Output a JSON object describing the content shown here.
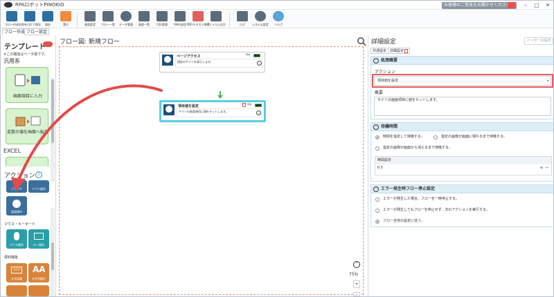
{
  "window": {
    "title": "RPAロボットPINOKIO",
    "feedback": "お客様のご意見をお聞かせください",
    "controls": [
      "‒",
      "□",
      "✕"
    ]
  },
  "toolbar": {
    "buttons": [
      {
        "label": "フロー作成",
        "icon": "new-flow-icon",
        "color": "#2f6f9f"
      },
      {
        "label": "名前を付けて保存",
        "icon": "save-as-icon",
        "color": "#2f6f9f"
      },
      {
        "label": "保存",
        "icon": "save-icon",
        "color": "#2f6f9f"
      },
      {
        "label": "実行",
        "icon": "run-icon",
        "color": "#f08a3c"
      },
      {
        "label": "画面設定",
        "icon": "screen-settings-icon",
        "color": "#5c6b7a"
      },
      {
        "label": "フロー一覧",
        "icon": "flow-list-icon",
        "color": "#5c6b7a"
      },
      {
        "label": "データ管理",
        "icon": "data-management-icon",
        "color": "#5c6b7a"
      },
      {
        "label": "画面一覧",
        "icon": "screen-list-icon",
        "color": "#5c6b7a"
      },
      {
        "label": "CSV変換",
        "icon": "csv-convert-icon",
        "color": "#5c6b7a"
      },
      {
        "label": "MAIL送信",
        "icon": "mail-send-icon",
        "color": "#5c6b7a"
      },
      {
        "label": "PDF/テキスト取得",
        "icon": "pdf-text-icon",
        "color": "#e06060"
      },
      {
        "label": "ファイル入出力",
        "icon": "file-io-icon",
        "color": "#5c6b7a"
      },
      {
        "label": "ログ",
        "icon": "log-icon",
        "color": "#5c6b7a"
      },
      {
        "label": "システム設定",
        "icon": "system-settings-icon",
        "color": "#5c6b7a"
      },
      {
        "label": "ヘルプ",
        "icon": "help-icon",
        "color": "#5aa3d9"
      }
    ]
  },
  "subtabs": [
    "フロー作成",
    "フロー設定"
  ],
  "template_panel": {
    "title": "テンプレート",
    "note": "※この機能はベータ版です。",
    "groups": [
      {
        "name": "汎用系",
        "cards": [
          {
            "label": "画面項目に入力"
          },
          {
            "label": "変数の値を画面へ転記"
          }
        ]
      },
      {
        "name": "EXCEL",
        "cards": []
      }
    ]
  },
  "action_panel": {
    "title": "アクション",
    "help": "?",
    "tiles_row1": [
      "ブラウザ",
      "アプリ操作"
    ],
    "tile_selected": "画面操作",
    "cat_mouse": "マウス・キーボード",
    "tiles_row2": [
      "マウス操作",
      "キー操作"
    ],
    "cat_util": "便利機能",
    "tiles_row3": [
      "文字認識",
      "文字列操作"
    ]
  },
  "flow": {
    "title": "フロー図: 新規フロー",
    "nodes": [
      {
        "title": "ページアクセス",
        "desc": "指定のサイトを表示します。",
        "status": "有効"
      },
      {
        "title": "項目値を設定",
        "desc": "サイトの画面項目に値をセットします。",
        "status": "有効"
      }
    ],
    "zoom": "75%",
    "zoom_in": "+",
    "zoom_out": "-"
  },
  "detail": {
    "title": "詳細設定",
    "trigger": "トリガーの設定",
    "tabs": [
      "共通設定",
      "詳細設定"
    ],
    "sections": [
      {
        "title": "処理概要",
        "action_label": "アクション",
        "action_value": "項目値を設定",
        "summary_label": "概要",
        "summary_value": "サイトの画面項目に値をセットします。"
      },
      {
        "title": "待機時間",
        "options": [
          {
            "label": "時間を指定して待機する。",
            "checked": true
          },
          {
            "label": "指定の画像が画面に現れるまで待機する。",
            "checked": false
          },
          {
            "label": "指定の画像が画面から消えるまで待機する。",
            "checked": false
          }
        ],
        "time_label": "時間設定",
        "time_value": "0.5",
        "time_ctrl": "+ −"
      },
      {
        "title": "エラー発生時フロー停止設定",
        "options": [
          {
            "label": "エラーが発生した場合、フローを一時停止する。",
            "checked": false
          },
          {
            "label": "エラーが発生してもフローを停止せず、次のアクションを実行する。",
            "checked": false
          },
          {
            "label": "フロー全体の設定に従う。",
            "checked": true
          }
        ]
      }
    ]
  },
  "colors": {
    "accent": "#57d0df",
    "highlight": "#e2585b",
    "section_header": "#ddeef7",
    "template_card": "#d8f3d0",
    "action_tile": "#3b6e9d"
  }
}
